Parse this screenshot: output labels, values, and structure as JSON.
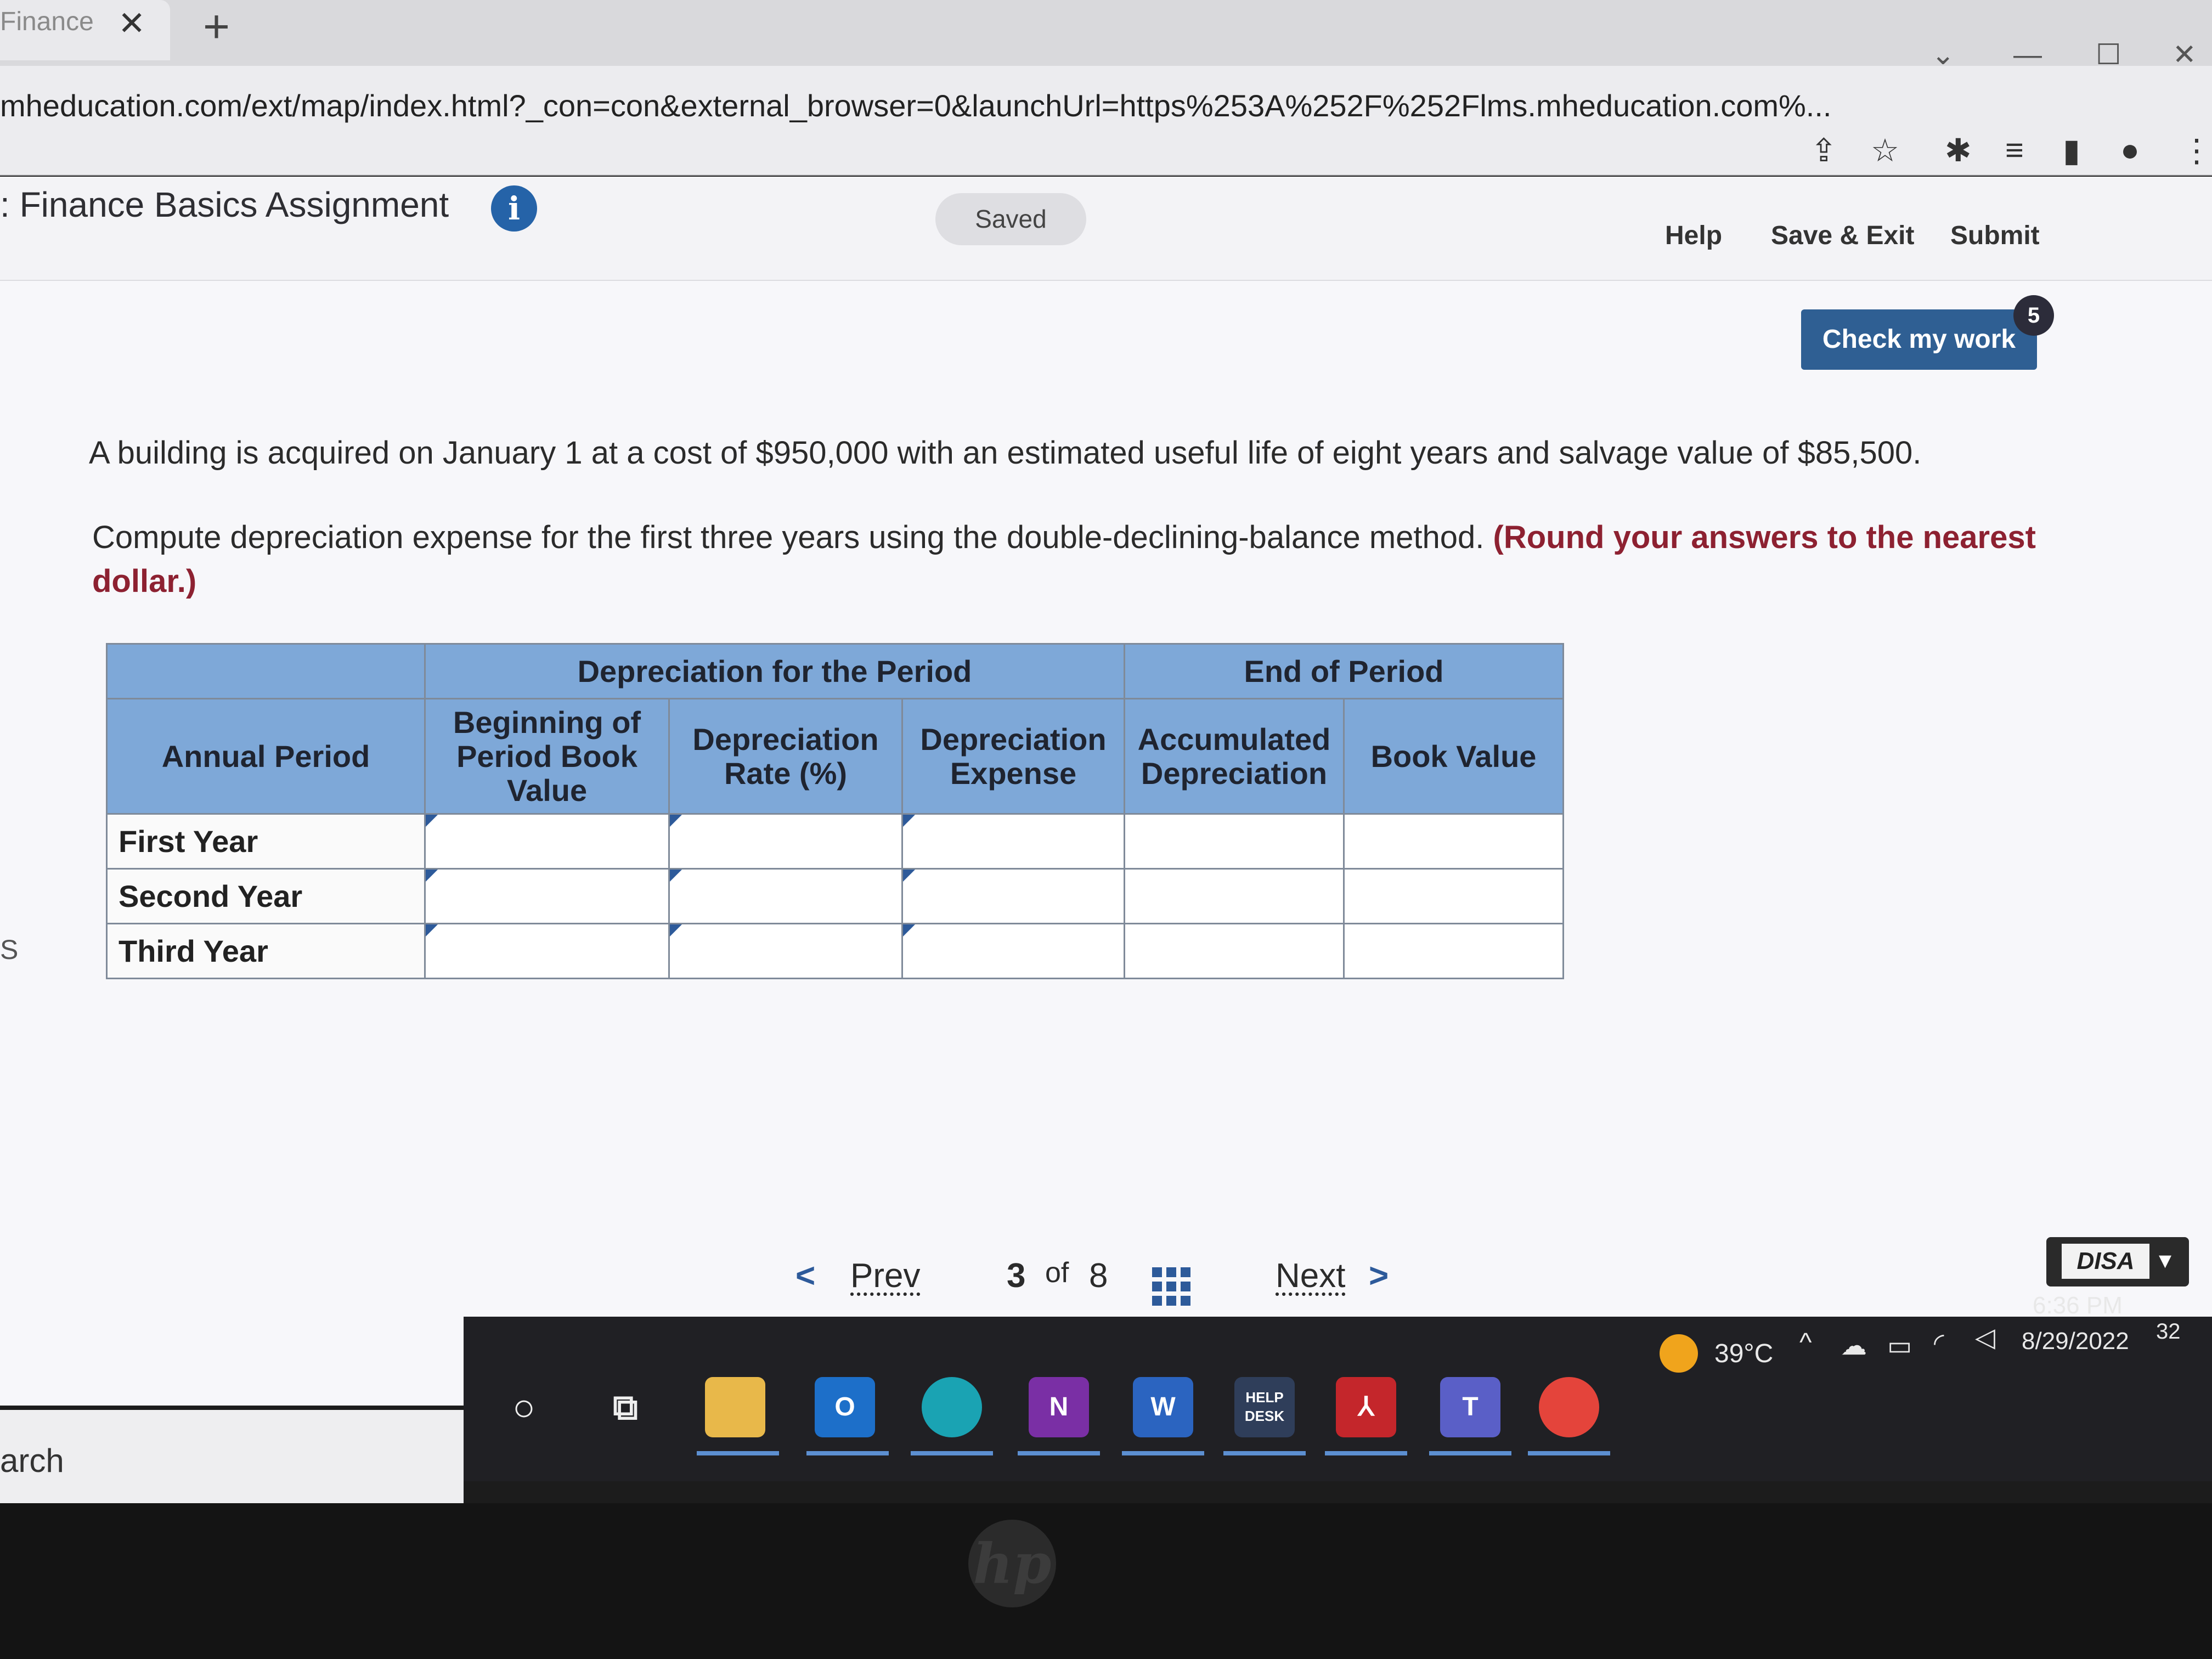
{
  "browser": {
    "tab_title": "Finance",
    "tab_close": "✕",
    "new_tab": "+",
    "url": "mheducation.com/ext/map/index.html?_con=con&external_browser=0&launchUrl=https%253A%252F%252Flms.mheducation.com%...",
    "icons": [
      "share-icon",
      "star-icon",
      "extensions-icon",
      "reading-list-icon",
      "sidepanel-icon",
      "profile-icon",
      "menu-icon"
    ]
  },
  "header": {
    "title": ": Finance Basics Assignment",
    "info": "i",
    "saved": "Saved",
    "help": "Help",
    "save_exit": "Save & Exit",
    "submit": "Submit"
  },
  "check": {
    "label": "Check my work",
    "badge": "5"
  },
  "question": {
    "line1": "A building is acquired on January 1 at a cost of $950,000 with an estimated useful life of eight years and salvage value of $85,500.",
    "line2": "Compute depreciation expense for the first three years using the double-declining-balance method.",
    "hint": "(Round your answers to the nearest dollar.)"
  },
  "table": {
    "group_depreciation": "Depreciation for the Period",
    "group_end": "End of Period",
    "col_period": "Annual Period",
    "col_beginning": "Beginning of Period Book Value",
    "col_rate": "Depreciation Rate (%)",
    "col_expense": "Depreciation Expense",
    "col_accum": "Accumulated Depreciation",
    "col_book": "Book Value",
    "rows": [
      {
        "label": "First Year",
        "beginning": "",
        "rate": "",
        "expense": ""
      },
      {
        "label": "Second Year",
        "beginning": "",
        "rate": "",
        "expense": ""
      },
      {
        "label": "Third Year",
        "beginning": "",
        "rate": "",
        "expense": ""
      }
    ]
  },
  "nav": {
    "prev": "Prev",
    "page_current": "3",
    "page_of": "of",
    "page_total": "8",
    "next": "Next"
  },
  "disa": "DISA",
  "taskbar": {
    "search": "arch",
    "apps": [
      "cortana-icon",
      "task-view-icon",
      "file-explorer-icon",
      "outlook-icon",
      "edge-icon",
      "onenote-icon",
      "word-icon",
      "help-desk-icon",
      "acrobat-icon",
      "teams-icon",
      "chrome-icon"
    ],
    "helpdesk_label": "HELP DESK",
    "temperature": "39°C",
    "time": "6:36 PM",
    "date": "8/29/2022",
    "notifications": "32"
  },
  "side_fragment": "S"
}
